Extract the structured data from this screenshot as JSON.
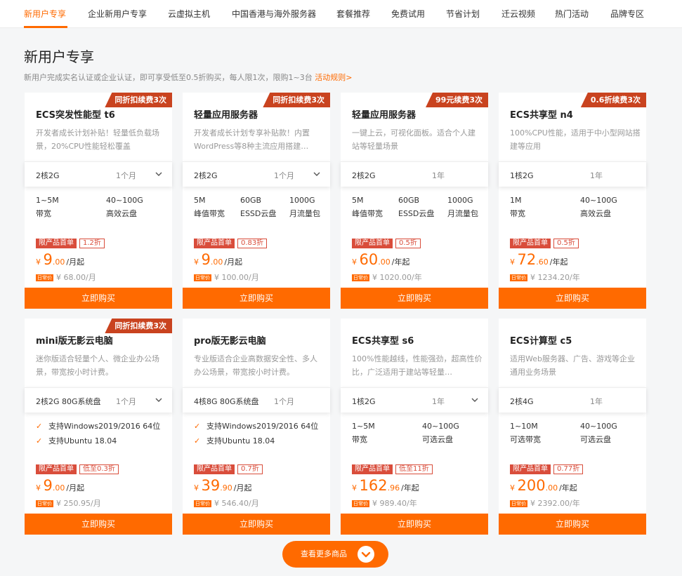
{
  "nav": {
    "tabs": [
      "新用户专享",
      "企业新用户专享",
      "云虚拟主机",
      "中国香港与海外服务器",
      "套餐推荐",
      "免费试用",
      "节省计划",
      "迁云视频",
      "热门活动",
      "品牌专区"
    ],
    "active": 0
  },
  "section": {
    "title": "新用户专享",
    "intro": "新用户完成实名认证或企业认证，即可享受低至0.5折购买，每人限1次，限购1~3台",
    "rules_link": "活动规则>"
  },
  "buy_label": "立即购买",
  "first_order_label": "限产品首单",
  "original_badge": "日常价",
  "more_button": "查看更多商品",
  "cards": [
    {
      "ribbon": "同折扣续费3次",
      "title": "ECS突发性能型 t6",
      "desc": "开发者成长计划补贴！轻量低负载场景，20%CPU性能轻松覆盖",
      "spec": "2核2G",
      "duration": "1个月",
      "dropdown": true,
      "attrs": [
        {
          "value": "1~5M",
          "label": "带宽"
        },
        {
          "value": "40~100G",
          "label": "高效云盘"
        }
      ],
      "discount": "1.2折",
      "price_int": "9",
      "price_dec": ".00",
      "price_unit": "/月起",
      "original": "¥ 68.00/月"
    },
    {
      "ribbon": "同折扣续费3次",
      "title": "轻量应用服务器",
      "desc": "开发者成长计划专享补贴款！内置WordPress等8种主流应用搭建…",
      "spec": "2核2G",
      "duration": "1个月",
      "dropdown": true,
      "attrs": [
        {
          "value": "5M",
          "label": "峰值带宽"
        },
        {
          "value": "60GB",
          "label": "ESSD云盘"
        },
        {
          "value": "1000G",
          "label": "月流量包"
        }
      ],
      "discount": "0.83折",
      "price_int": "9",
      "price_dec": ".00",
      "price_unit": "/月起",
      "original": "¥ 100.00/月"
    },
    {
      "ribbon": "99元续费3次",
      "title": "轻量应用服务器",
      "desc": "一键上云，可视化面板。适合个人建站等轻量场景",
      "spec": "2核2G",
      "duration": "1年",
      "dropdown": false,
      "attrs": [
        {
          "value": "5M",
          "label": "峰值带宽"
        },
        {
          "value": "60GB",
          "label": "ESSD云盘"
        },
        {
          "value": "1000G",
          "label": "月流量包"
        }
      ],
      "discount": "0.5折",
      "price_int": "60",
      "price_dec": ".00",
      "price_unit": "/年起",
      "original": "¥ 1020.00/年"
    },
    {
      "ribbon": "0.6折续费3次",
      "title": "ECS共享型 n4",
      "desc": "100%CPU性能，适用于中小型网站搭建等应用",
      "spec": "1核2G",
      "duration": "1年",
      "dropdown": false,
      "attrs": [
        {
          "value": "1M",
          "label": "带宽"
        },
        {
          "value": "40~100G",
          "label": "高效云盘"
        }
      ],
      "discount": "0.5折",
      "price_int": "72",
      "price_dec": ".60",
      "price_unit": "/年起",
      "original": "¥ 1234.20/年"
    },
    {
      "ribbon": "同折扣续费3次",
      "title": "mini版无影云电脑",
      "desc": "迷你版适合轻量个人、微企业办公场景，带宽按小时计费。",
      "spec": "2核2G 80G系统盘",
      "duration": "1个月",
      "dropdown": true,
      "checks": [
        "支持Windows2019/2016 64位",
        "支持Ubuntu 18.04"
      ],
      "discount": "低至0.3折",
      "price_int": "9",
      "price_dec": ".00",
      "price_unit": "/月起",
      "original": "¥ 250.95/月"
    },
    {
      "ribbon": "",
      "title": "pro版无影云电脑",
      "desc": "专业版适合企业高数据安全性、多人办公场景，带宽按小时计费。",
      "spec": "4核8G 80G系统盘",
      "duration": "1个月",
      "dropdown": false,
      "checks": [
        "支持Windows2019/2016 64位",
        "支持Ubuntu 18.04"
      ],
      "discount": "0.7折",
      "price_int": "39",
      "price_dec": ".90",
      "price_unit": "/月起",
      "original": "¥ 546.40/月"
    },
    {
      "ribbon": "",
      "title": "ECS共享型 s6",
      "desc": "100%性能越线，性能强劲，超高性价比，广泛适用于建站等轻量…",
      "spec": "1核2G",
      "duration": "1年",
      "dropdown": true,
      "attrs": [
        {
          "value": "1~5M",
          "label": "带宽"
        },
        {
          "value": "40~100G",
          "label": "可选云盘"
        }
      ],
      "discount": "低至11折",
      "price_int": "162",
      "price_dec": ".96",
      "price_unit": "/年起",
      "original": "¥ 989.40/年"
    },
    {
      "ribbon": "",
      "title": "ECS计算型 c5",
      "desc": "适用Web服务器、广告、游戏等企业通用业务场景",
      "spec": "2核4G",
      "duration": "1年",
      "dropdown": false,
      "attrs": [
        {
          "value": "1~10M",
          "label": "可选带宽"
        },
        {
          "value": "40~100G",
          "label": "可选云盘"
        }
      ],
      "discount": "0.77折",
      "price_int": "200",
      "price_dec": ".00",
      "price_unit": "/年起",
      "original": "¥ 2392.00/年"
    }
  ]
}
